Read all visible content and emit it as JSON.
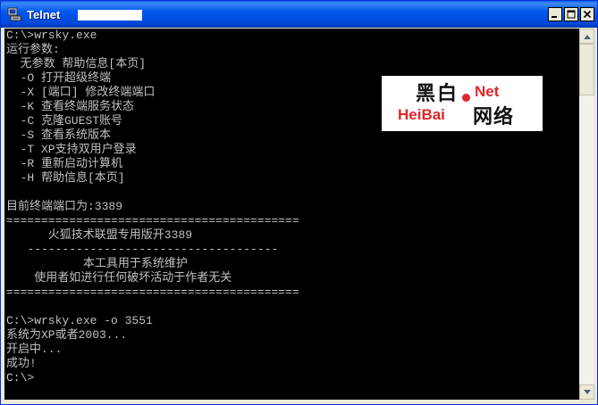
{
  "window": {
    "title": "Telnet",
    "controls": {
      "minimize_icon": "minimize-icon",
      "maximize_icon": "maximize-icon",
      "close_icon": "close-icon"
    }
  },
  "console": {
    "lines": [
      "C:\\>wrsky.exe",
      "运行参数:",
      "  无参数 帮助信息[本页]",
      "  -O 打开超级终端",
      "  -X [端口] 修改终端端口",
      "  -K 查看终端服务状态",
      "  -C 克隆GUEST账号",
      "  -S 查看系统版本",
      "  -T XP支持双用户登录",
      "  -R 重新启动计算机",
      "  -H 帮助信息[本页]",
      "",
      "目前终端端口为:3389",
      "==========================================",
      "      火狐技术联盟专用版开3389",
      "   ------------------------------------",
      "           本工具用于系统维护",
      "    使用者如进行任何破坏活动于作者无关",
      "==========================================",
      "",
      "C:\\>wrsky.exe -o 3551",
      "系统为XP或者2003...",
      "开启中...",
      "成功!",
      "C:\\>"
    ]
  },
  "watermark": {
    "text_cn_top": "黑白",
    "text_net": "Net",
    "text_heibai": "HeiBai",
    "text_cn_bottom": "网络"
  },
  "colors": {
    "console_bg": "#000000",
    "console_text": "#c0c0c0",
    "titlebar": "#0058ee",
    "watermark_red": "#e0262a"
  }
}
